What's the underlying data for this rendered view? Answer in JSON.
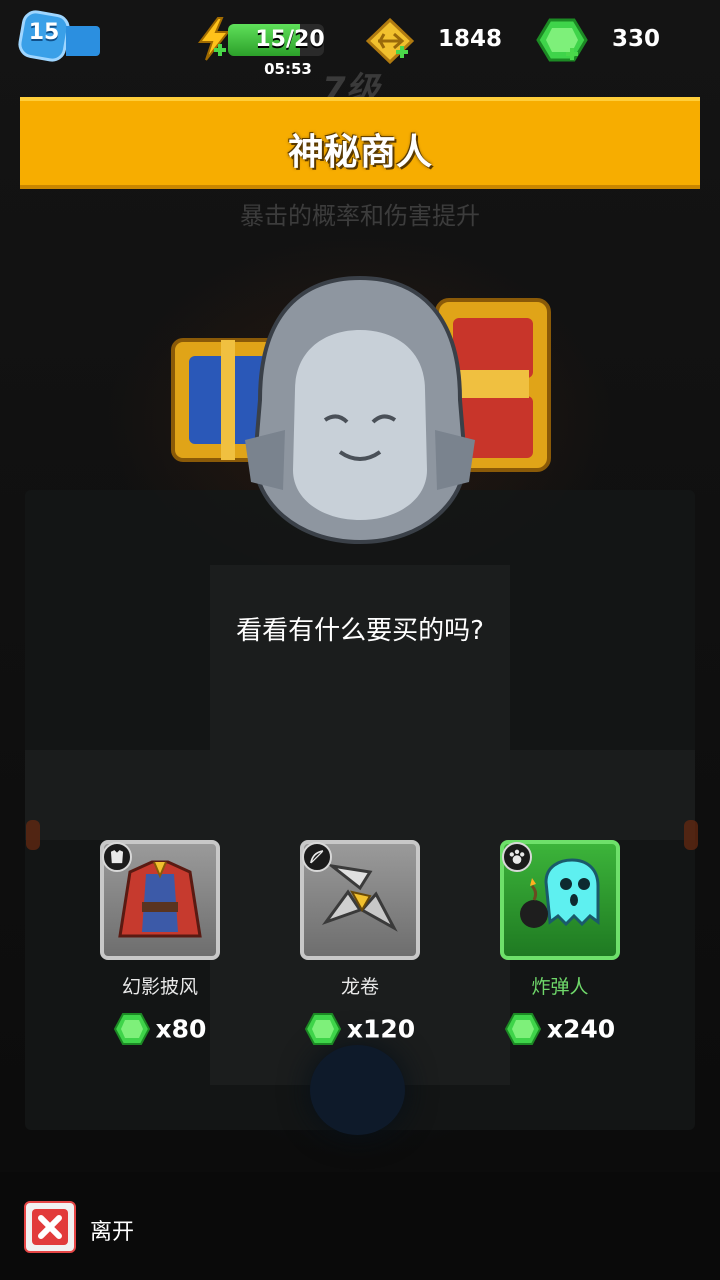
{
  "hud": {
    "level": "15",
    "energy": {
      "value": 15,
      "max": 20,
      "text": "15/20",
      "timer": "05:53"
    },
    "coins": "1848",
    "gems": "330"
  },
  "background": {
    "chapter": "7级",
    "skill_hint": "暴击的概率和伤害提升"
  },
  "dialog": {
    "title": "神秘商人",
    "prompt": "看看有什么要买的吗?"
  },
  "shop": {
    "items": [
      {
        "name": "幻影披风",
        "price": "x80",
        "type_icon": "armor-icon",
        "art_icon": "cloak-icon",
        "rarity": "gray"
      },
      {
        "name": "龙卷",
        "price": "x120",
        "type_icon": "bow-icon",
        "art_icon": "tornado-shuriken-icon",
        "rarity": "gray"
      },
      {
        "name": "炸弹人",
        "price": "x240",
        "type_icon": "paw-icon",
        "art_icon": "bomb-ghost-icon",
        "rarity": "green"
      }
    ]
  },
  "footer": {
    "leave_label": "离开"
  },
  "colors": {
    "banner": "#f7ad00",
    "gem": "#3fd44a",
    "leave": "#e23b3b",
    "rare_green": "#6fd86a"
  }
}
